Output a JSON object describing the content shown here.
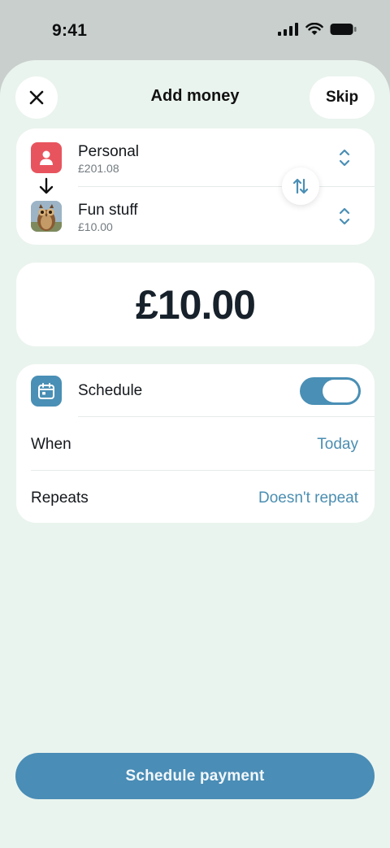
{
  "status_bar": {
    "time": "9:41"
  },
  "header": {
    "title": "Add money",
    "skip_label": "Skip"
  },
  "accounts": {
    "from": {
      "name": "Personal",
      "balance": "£201.08"
    },
    "to": {
      "name": "Fun stuff",
      "balance": "£10.00"
    }
  },
  "amount": {
    "value": "£10.00"
  },
  "schedule": {
    "label": "Schedule",
    "enabled": true,
    "when_label": "When",
    "when_value": "Today",
    "repeats_label": "Repeats",
    "repeats_value": "Doesn't repeat"
  },
  "cta": {
    "label": "Schedule payment"
  },
  "colors": {
    "accent": "#4a8fb5",
    "background": "#eaf4ee",
    "personal_avatar": "#e8545e",
    "link_text": "#4b8eb1"
  },
  "icons": [
    "signal-icon",
    "wifi-icon",
    "battery-icon",
    "close-icon",
    "person-icon",
    "arrow-down-icon",
    "owl-avatar",
    "swap-icon",
    "chevron-updown-icon",
    "calendar-icon"
  ]
}
